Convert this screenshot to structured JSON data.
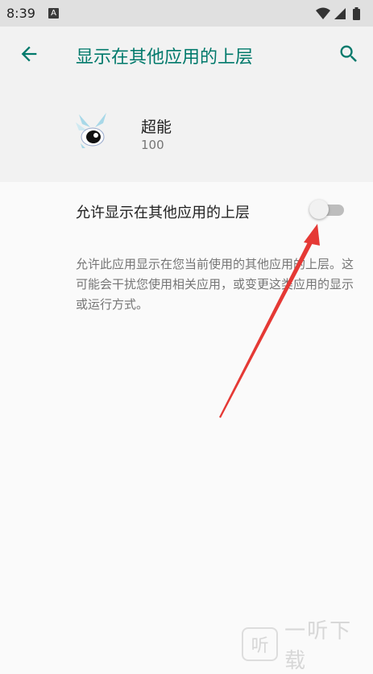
{
  "status_bar": {
    "time": "8:39",
    "notification_icon": "A",
    "icons": [
      "wifi-icon",
      "signal-icon",
      "battery-icon"
    ]
  },
  "appbar": {
    "title": "显示在其他应用的上层",
    "back_icon": "arrow-left-icon",
    "search_icon": "search-icon",
    "accent_color": "#00796b"
  },
  "app_info": {
    "name": "超能",
    "version": "100"
  },
  "setting": {
    "label": "允许显示在其他应用的上层",
    "enabled": false
  },
  "description": "允许此应用显示在您当前使用的其他应用的上层。这可能会干扰您使用相关应用，或变更这类应用的显示或运行方式。",
  "watermark": {
    "logo_text": "听",
    "text": "一听下载"
  }
}
